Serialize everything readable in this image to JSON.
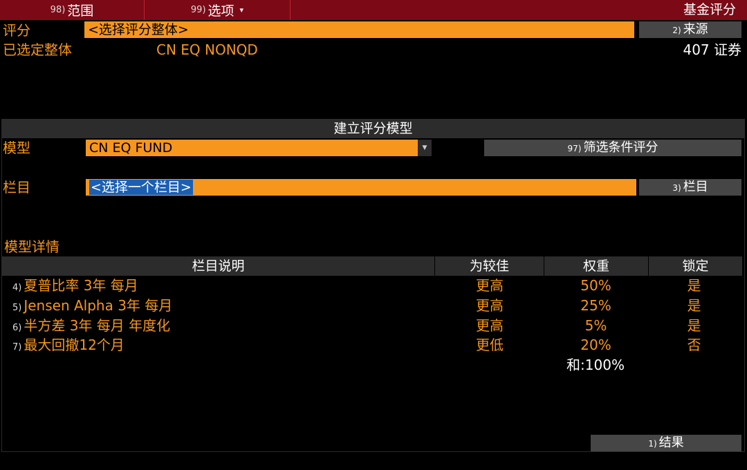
{
  "topbar": {
    "range": {
      "fn": "98)",
      "label": "范围"
    },
    "options": {
      "fn": "99)",
      "label": "选项",
      "caret": "▾"
    },
    "title": "基金评分"
  },
  "score": {
    "label": "评分",
    "field_value": "<选择评分整体>",
    "source_button": {
      "fn": "2)",
      "label": "来源"
    }
  },
  "selected": {
    "label": "已选定整体",
    "value": "CN EQ NONQD",
    "count": "407 证券"
  },
  "builder": {
    "section_title": "建立评分模型",
    "model": {
      "label": "模型",
      "value": "CN EQ FUND",
      "dropdown_icon": "caret-down-icon"
    },
    "filter_button": {
      "fn": "97)",
      "label": "筛选条件评分"
    },
    "column": {
      "label": "栏目",
      "field_value": "<选择一个栏目>"
    },
    "column_button": {
      "fn": "3)",
      "label": "栏目"
    }
  },
  "details": {
    "title": "模型详情",
    "headers": [
      "栏目说明",
      "为较佳",
      "权重",
      "锁定"
    ],
    "rows": [
      {
        "num": "4)",
        "desc": "夏普比率 3年 每月",
        "better": "更高",
        "weight": "50%",
        "locked": "是"
      },
      {
        "num": "5)",
        "desc": "Jensen Alpha 3年 每月",
        "better": "更高",
        "weight": "25%",
        "locked": "是"
      },
      {
        "num": "6)",
        "desc": "半方差 3年 每月 年度化",
        "better": "更高",
        "weight": "5%",
        "locked": "是"
      },
      {
        "num": "7)",
        "desc": "最大回撤12个月",
        "better": "更低",
        "weight": "20%",
        "locked": "否"
      }
    ],
    "sum": "和:100%"
  },
  "results_button": {
    "fn": "1)",
    "label": "结果"
  },
  "colors": {
    "accent_orange": "#f7961d",
    "top_bar_red": "#7b0a16",
    "panel_gray": "#2c2c2c",
    "button_gray": "#464646",
    "selection_blue": "#1b5fb4"
  }
}
